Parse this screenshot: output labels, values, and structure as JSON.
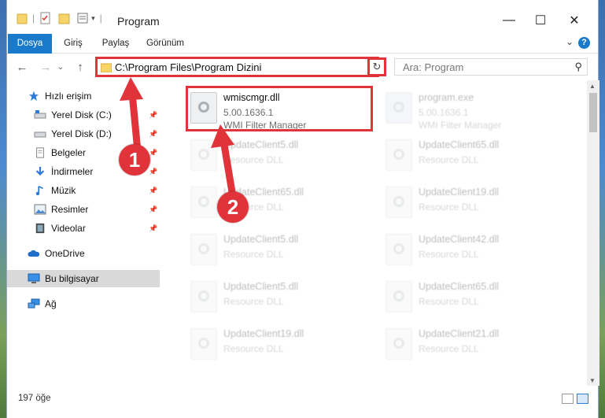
{
  "window": {
    "title": "Program",
    "controls": {
      "minimize": "—",
      "maximize": "☐",
      "close": "✕"
    }
  },
  "ribbon": {
    "tabs": [
      "Dosya",
      "Giriş",
      "Paylaş",
      "Görünüm"
    ],
    "expand_glyph": "⌄",
    "help_glyph": "?"
  },
  "nav": {
    "back": "←",
    "forward": "→",
    "recent": "⌄",
    "up": "↑",
    "address": "C:\\Program Files\\Program Dizini",
    "address_chevron": "⌄",
    "refresh": "↻",
    "search_placeholder": "Ara: Program",
    "search_glyph": "⚲"
  },
  "sidebar": {
    "items": [
      {
        "label": "Hızlı erişim",
        "icon": "star-icon"
      },
      {
        "label": "Yerel Disk (C:)",
        "icon": "drive-icon"
      },
      {
        "label": "Yerel Disk (D:)",
        "icon": "drive-icon"
      },
      {
        "label": "Belgeler",
        "icon": "documents-icon"
      },
      {
        "label": "İndirmeler",
        "icon": "download-icon"
      },
      {
        "label": "Müzik",
        "icon": "music-icon"
      },
      {
        "label": "Resimler",
        "icon": "pictures-icon"
      },
      {
        "label": "Videolar",
        "icon": "video-icon"
      },
      {
        "label": "OneDrive",
        "icon": "cloud-icon"
      },
      {
        "label": "Bu bilgisayar",
        "icon": "computer-icon"
      },
      {
        "label": "Ağ",
        "icon": "network-icon"
      }
    ],
    "pin_glyph": "📌"
  },
  "files": [
    {
      "name": "wmiscmgr.dll",
      "version": "5.00.1636.1",
      "desc": "WMI Filter Manager",
      "highlighted": true
    },
    {
      "name": "program.exe",
      "version": "5.00.1636.1",
      "desc": "WMI Filter Manager"
    },
    {
      "name": "UpdateClient5.dll",
      "desc": "Resource DLL"
    },
    {
      "name": "UpdateClient65.dll",
      "desc": "Resource DLL"
    },
    {
      "name": "UpdateClient65.dll",
      "desc": "Resource DLL"
    },
    {
      "name": "UpdateClient19.dll",
      "desc": "Resource DLL"
    },
    {
      "name": "UpdateClient5.dll",
      "desc": "Resource DLL"
    },
    {
      "name": "UpdateClient42.dll",
      "desc": "Resource DLL"
    },
    {
      "name": "UpdateClient5.dll",
      "desc": "Resource DLL"
    },
    {
      "name": "UpdateClient65.dll",
      "desc": "Resource DLL"
    },
    {
      "name": "UpdateClient19.dll",
      "desc": "Resource DLL"
    },
    {
      "name": "UpdateClient21.dll",
      "desc": "Resource DLL"
    }
  ],
  "status": {
    "count": "197 öğe"
  },
  "annotations": {
    "step1": "1",
    "step2": "2"
  },
  "colors": {
    "accent": "#1979ca",
    "highlight": "#e0333a"
  }
}
